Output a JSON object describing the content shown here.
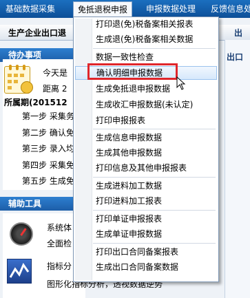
{
  "menubar": {
    "items": [
      {
        "label": "基础数据采集"
      },
      {
        "label": "免抵退税申报"
      },
      {
        "label": "申报数据处理"
      },
      {
        "label": "反馈信息处"
      }
    ]
  },
  "window": {
    "title": "生产企业出口退",
    "right_title": "出口"
  },
  "todo": {
    "title": "待办事项",
    "today_prefix": "今天是",
    "distance_prefix": "距离 2",
    "period_label": "所属期(201512",
    "steps": [
      "第一步 采集务",
      "第二步 确认免",
      "第三步 录入均",
      "第四步 采集免",
      "第五步 生成免"
    ]
  },
  "tools": {
    "title": "辅助工具",
    "sys_check_line1": "系统体",
    "sys_check_line2": "全面检",
    "indicator_line1": "指标分",
    "indicator_line2": "图形化指标分析，透视数据逆势"
  },
  "dropdown": {
    "groups": [
      [
        "打印退(免)税备案相关报表",
        "生成退(免)税备案相关数据"
      ],
      [
        "数据一致性检查",
        "确认明细申报数据",
        "生成免抵退申报数据",
        "生成收汇申报数据(未认定)",
        "打印申报报表"
      ],
      [
        "生成信息申报数据",
        "生成其他申报数据",
        "打印信息及其他申报报表"
      ],
      [
        "生成进料加工数据",
        "打印进料加工报表"
      ],
      [
        "打印单证申报报表",
        "生成单证申报数据"
      ],
      [
        "打印出口合同备案报表",
        "生成出口合同备案数据"
      ]
    ],
    "highlighted_item": "确认明细申报数据"
  },
  "colors": {
    "menubar": "#1b6fbf",
    "highlight_border": "#e0262b",
    "hover_bg": "#d6e8fb"
  }
}
